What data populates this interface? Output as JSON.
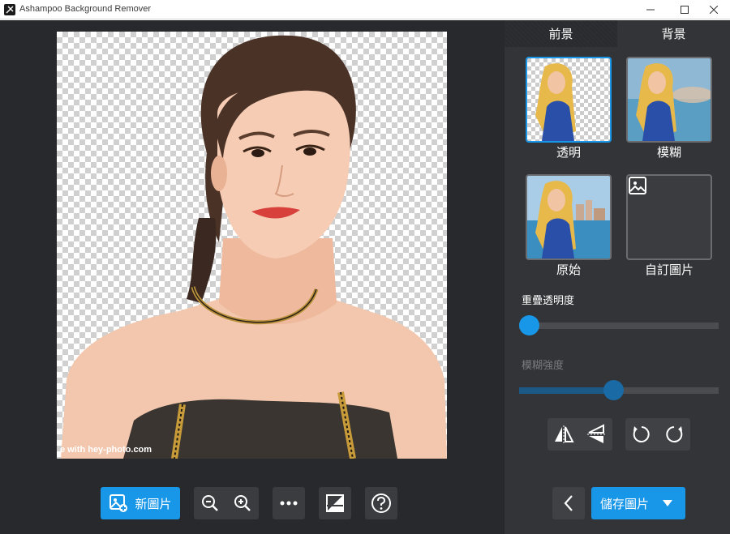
{
  "window": {
    "title": "Ashampoo Background Remover"
  },
  "canvas": {
    "watermark": "e with hey-photo.com"
  },
  "toolbar": {
    "new_image_label": "新圖片"
  },
  "panel": {
    "tabs": [
      {
        "label": "前景"
      },
      {
        "label": "背景"
      }
    ],
    "backgrounds": [
      {
        "label": "透明"
      },
      {
        "label": "模糊"
      },
      {
        "label": "原始"
      },
      {
        "label": "自訂圖片"
      }
    ],
    "overlay_opacity": {
      "label": "重疊透明度",
      "value": 0.0
    },
    "blur_strength": {
      "label": "模糊強度",
      "value": 0.47
    },
    "save_label": "儲存圖片"
  },
  "colors": {
    "accent": "#1896e8",
    "panel_bg": "#323437",
    "canvas_bg": "#27292c"
  }
}
